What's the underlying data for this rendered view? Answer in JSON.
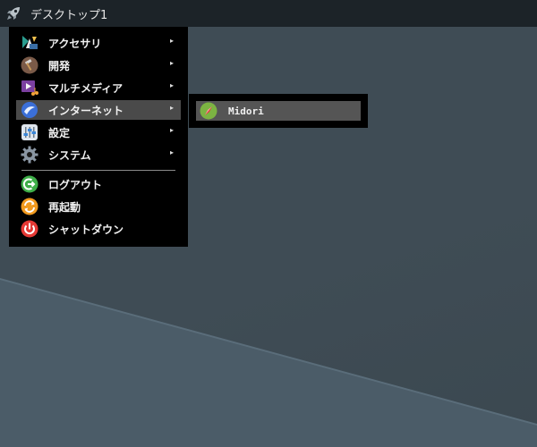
{
  "taskbar": {
    "workspace_label": "デスクトップ1",
    "launcher_icon": "rocket-icon"
  },
  "menu": {
    "items": [
      {
        "label": "アクセサリ",
        "icon": "accessories-icon",
        "has_submenu": true
      },
      {
        "label": "開発",
        "icon": "development-icon",
        "has_submenu": true
      },
      {
        "label": "マルチメディア",
        "icon": "multimedia-icon",
        "has_submenu": true
      },
      {
        "label": "インターネット",
        "icon": "internet-icon",
        "has_submenu": true,
        "active": true
      },
      {
        "label": "設定",
        "icon": "settings-icon",
        "has_submenu": true
      },
      {
        "label": "システム",
        "icon": "system-icon",
        "has_submenu": true
      },
      {
        "label": "ログアウト",
        "icon": "logout-icon",
        "has_submenu": false
      },
      {
        "label": "再起動",
        "icon": "restart-icon",
        "has_submenu": false
      },
      {
        "label": "シャットダウン",
        "icon": "shutdown-icon",
        "has_submenu": false
      }
    ],
    "submenu_arrow": "▸"
  },
  "submenu": {
    "items": [
      {
        "label": "Midori",
        "icon": "midori-icon"
      }
    ]
  }
}
